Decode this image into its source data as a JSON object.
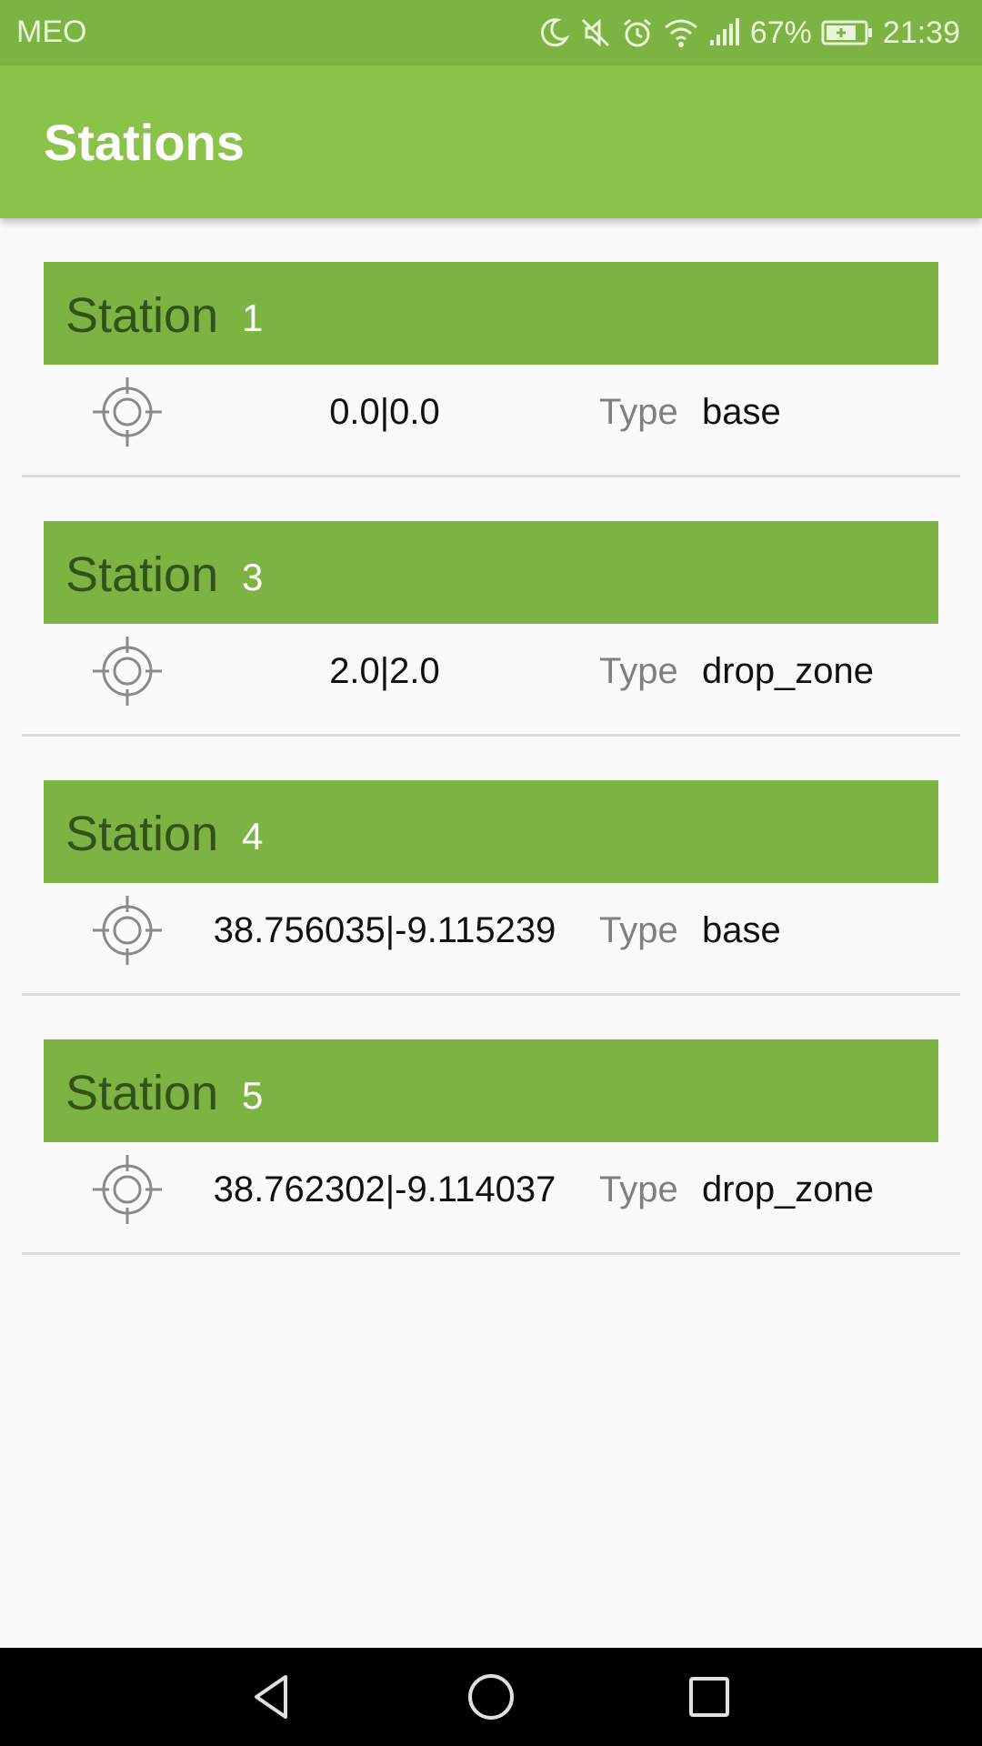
{
  "status_bar": {
    "carrier": "MEO",
    "battery": "67%",
    "time": "21:39"
  },
  "app_bar": {
    "title": "Stations"
  },
  "stations": [
    {
      "label": "Station",
      "number": "1",
      "coords": "0.0|0.0",
      "type_label": "Type",
      "type": "base"
    },
    {
      "label": "Station",
      "number": "3",
      "coords": "2.0|2.0",
      "type_label": "Type",
      "type": "drop_zone"
    },
    {
      "label": "Station",
      "number": "4",
      "coords": "38.756035|-9.115239",
      "type_label": "Type",
      "type": "base"
    },
    {
      "label": "Station",
      "number": "5",
      "coords": "38.762302|-9.114037",
      "type_label": "Type",
      "type": "drop_zone"
    }
  ],
  "icons": {
    "status": [
      "moon-icon",
      "mute-icon",
      "alarm-icon",
      "wifi-icon",
      "signal-icon",
      "battery-icon"
    ],
    "row": "crosshair-target-icon",
    "nav": [
      "back-icon",
      "home-icon",
      "recents-icon"
    ]
  },
  "colors": {
    "status_bar": "#7cb342",
    "app_bar": "#8bc34a",
    "station_header": "#7cb342",
    "station_word": "#33521a"
  }
}
